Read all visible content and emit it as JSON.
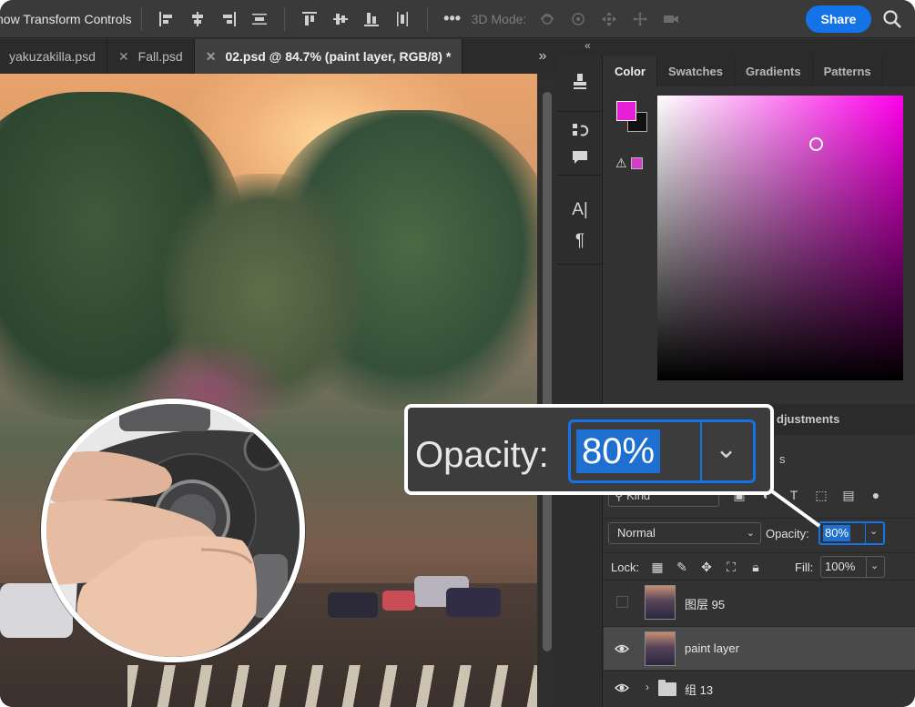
{
  "options_bar": {
    "transform_label": "how Transform Controls",
    "mode3d_label": "3D Mode:",
    "share_label": "Share"
  },
  "tabs": [
    {
      "label": "yakuzakilla.psd",
      "active": false,
      "closable": false
    },
    {
      "label": "Fall.psd",
      "active": false,
      "closable": true
    },
    {
      "label": "02.psd @ 84.7% (paint layer, RGB/8) *",
      "active": true,
      "closable": true
    }
  ],
  "tabs_more": "»",
  "panel_collapse": "«",
  "color_panel": {
    "tabs": [
      "Color",
      "Swatches",
      "Gradients",
      "Patterns"
    ],
    "active_tab": "Color",
    "foreground": "#e51fd8",
    "background": "#111111",
    "hue_color": "#ff00ea"
  },
  "layers_panel": {
    "adjustments_tab_fragment": "djustments",
    "second_tab_fragment": "s",
    "kind_filter": "Kind",
    "blend_mode": "Normal",
    "opacity_label": "Opacity:",
    "opacity_value": "80%",
    "lock_label": "Lock:",
    "fill_label": "Fill:",
    "fill_value": "100%",
    "layers": [
      {
        "name": "图层 95",
        "visible": false,
        "selected": false,
        "type": "pixel"
      },
      {
        "name": "paint layer",
        "visible": true,
        "selected": true,
        "type": "pixel"
      },
      {
        "name": "组 13",
        "visible": true,
        "selected": false,
        "type": "group"
      }
    ]
  },
  "callout": {
    "label": "Opacity:",
    "value": "80%"
  },
  "colors": {
    "accent": "#1473e6",
    "selection": "#1f6fd1"
  }
}
